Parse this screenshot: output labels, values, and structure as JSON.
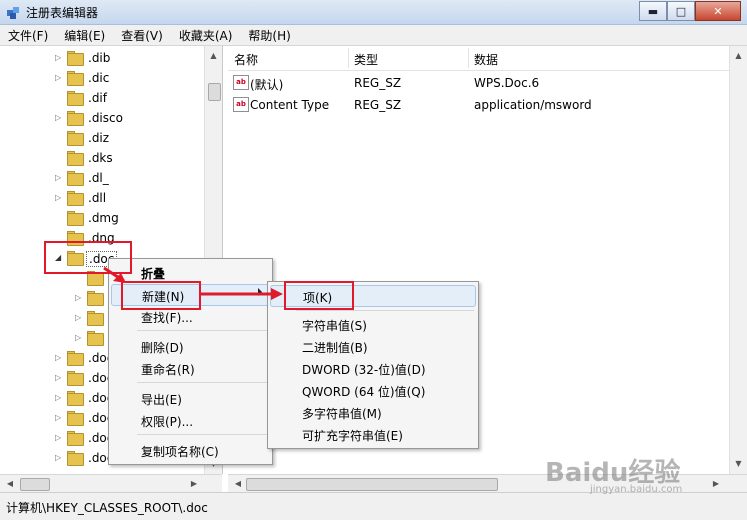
{
  "window": {
    "title": "注册表编辑器",
    "controls": {
      "minimize": "▬",
      "maximize": "□",
      "close": "✕"
    }
  },
  "menubar": [
    "文件(F)",
    "编辑(E)",
    "查看(V)",
    "收藏夹(A)",
    "帮助(H)"
  ],
  "tree": {
    "nodes": [
      ".dib",
      ".dic",
      ".dif",
      ".disco",
      ".diz",
      ".dks",
      ".dl_",
      ".dll",
      ".dmg",
      ".dng",
      ".doc"
    ],
    "selected": ".doc",
    "lower_nodes": [
      ".doc",
      ".doc",
      ".doc",
      ".doc",
      ".doc",
      ".doc"
    ]
  },
  "list": {
    "headers": [
      "名称",
      "类型",
      "数据"
    ],
    "rows": [
      {
        "name": "(默认)",
        "type": "REG_SZ",
        "data": "WPS.Doc.6",
        "icon": "string-value-icon"
      },
      {
        "name": "Content Type",
        "type": "REG_SZ",
        "data": "application/msword",
        "icon": "string-value-icon"
      }
    ]
  },
  "context_menu": {
    "items": [
      "折叠",
      "新建(N)",
      "查找(F)...",
      "删除(D)",
      "重命名(R)",
      "导出(E)",
      "权限(P)...",
      "复制项名称(C)"
    ]
  },
  "submenu": {
    "items": [
      "项(K)",
      "字符串值(S)",
      "二进制值(B)",
      "DWORD (32-位)值(D)",
      "QWORD (64 位)值(Q)",
      "多字符串值(M)",
      "可扩充字符串值(E)"
    ]
  },
  "statusbar": {
    "path": "计算机\\HKEY_CLASSES_ROOT\\.doc"
  },
  "watermark": {
    "text": "Baidu经验",
    "sub": "jingyan.baidu.com"
  },
  "colors": {
    "highlight_box": "#e01a2a",
    "folder": "#e6c24e"
  }
}
